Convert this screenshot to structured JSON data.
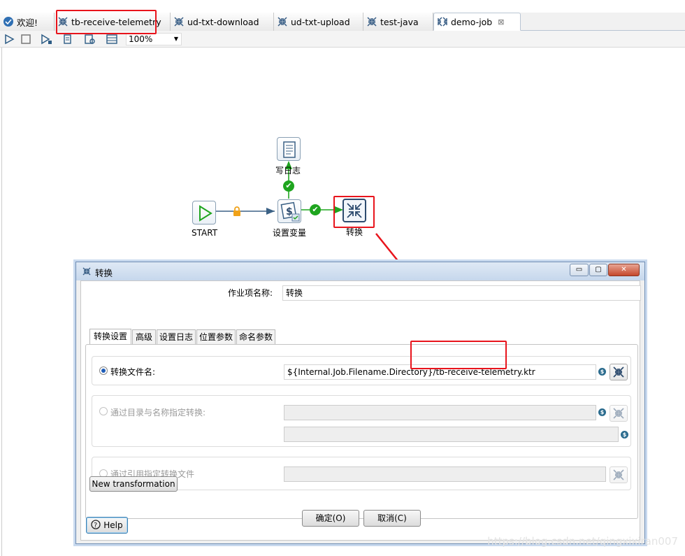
{
  "tabs": [
    {
      "label": "欢迎!",
      "icon": "welcome-icon"
    },
    {
      "label": "tb-receive-telemetry",
      "icon": "transformation-icon"
    },
    {
      "label": "ud-txt-download",
      "icon": "transformation-icon"
    },
    {
      "label": "ud-txt-upload",
      "icon": "transformation-icon"
    },
    {
      "label": "test-java",
      "icon": "transformation-icon"
    },
    {
      "label": "demo-job",
      "icon": "job-icon",
      "active": true,
      "close": "⊠"
    }
  ],
  "toolbar": {
    "icons": [
      "run-icon",
      "stop-icon",
      "run-options-icon",
      "replay-icon",
      "verify-icon",
      "sql-icon"
    ],
    "zoom": "100%"
  },
  "canvas": {
    "nodes": {
      "start": "START",
      "set_var": "设置变量",
      "write_log": "写日志",
      "transform": "转换"
    },
    "hops": {
      "check": "✔",
      "lock": "lock-icon"
    }
  },
  "dialog": {
    "title": "转换",
    "window_buttons": {
      "minimize": "▭",
      "maximize": "▢",
      "close": "✕"
    },
    "name_label": "作业项名称:",
    "name_value": "转换",
    "tabs": [
      "转换设置",
      "高级",
      "设置日志",
      "位置参数",
      "命名参数"
    ],
    "option_file_label": "转换文件名:",
    "option_file_value": "${Internal.Job.Filename.Directory}/tb-receive-telemetry.ktr",
    "option_repo_label": "通过目录与名称指定转换:",
    "option_ref_label": "通过引用指定转换文件",
    "var_symbol": "$",
    "new_transformation": "New transformation",
    "help": "Help",
    "ok": "确定(O)",
    "cancel": "取消(C)"
  },
  "watermark": "https://blog.csdn.net/qingxixiran007",
  "colors": {
    "highlight": "#e8141c",
    "hop_ok": "#1fa51f",
    "node_border": "#8aa0b4"
  }
}
